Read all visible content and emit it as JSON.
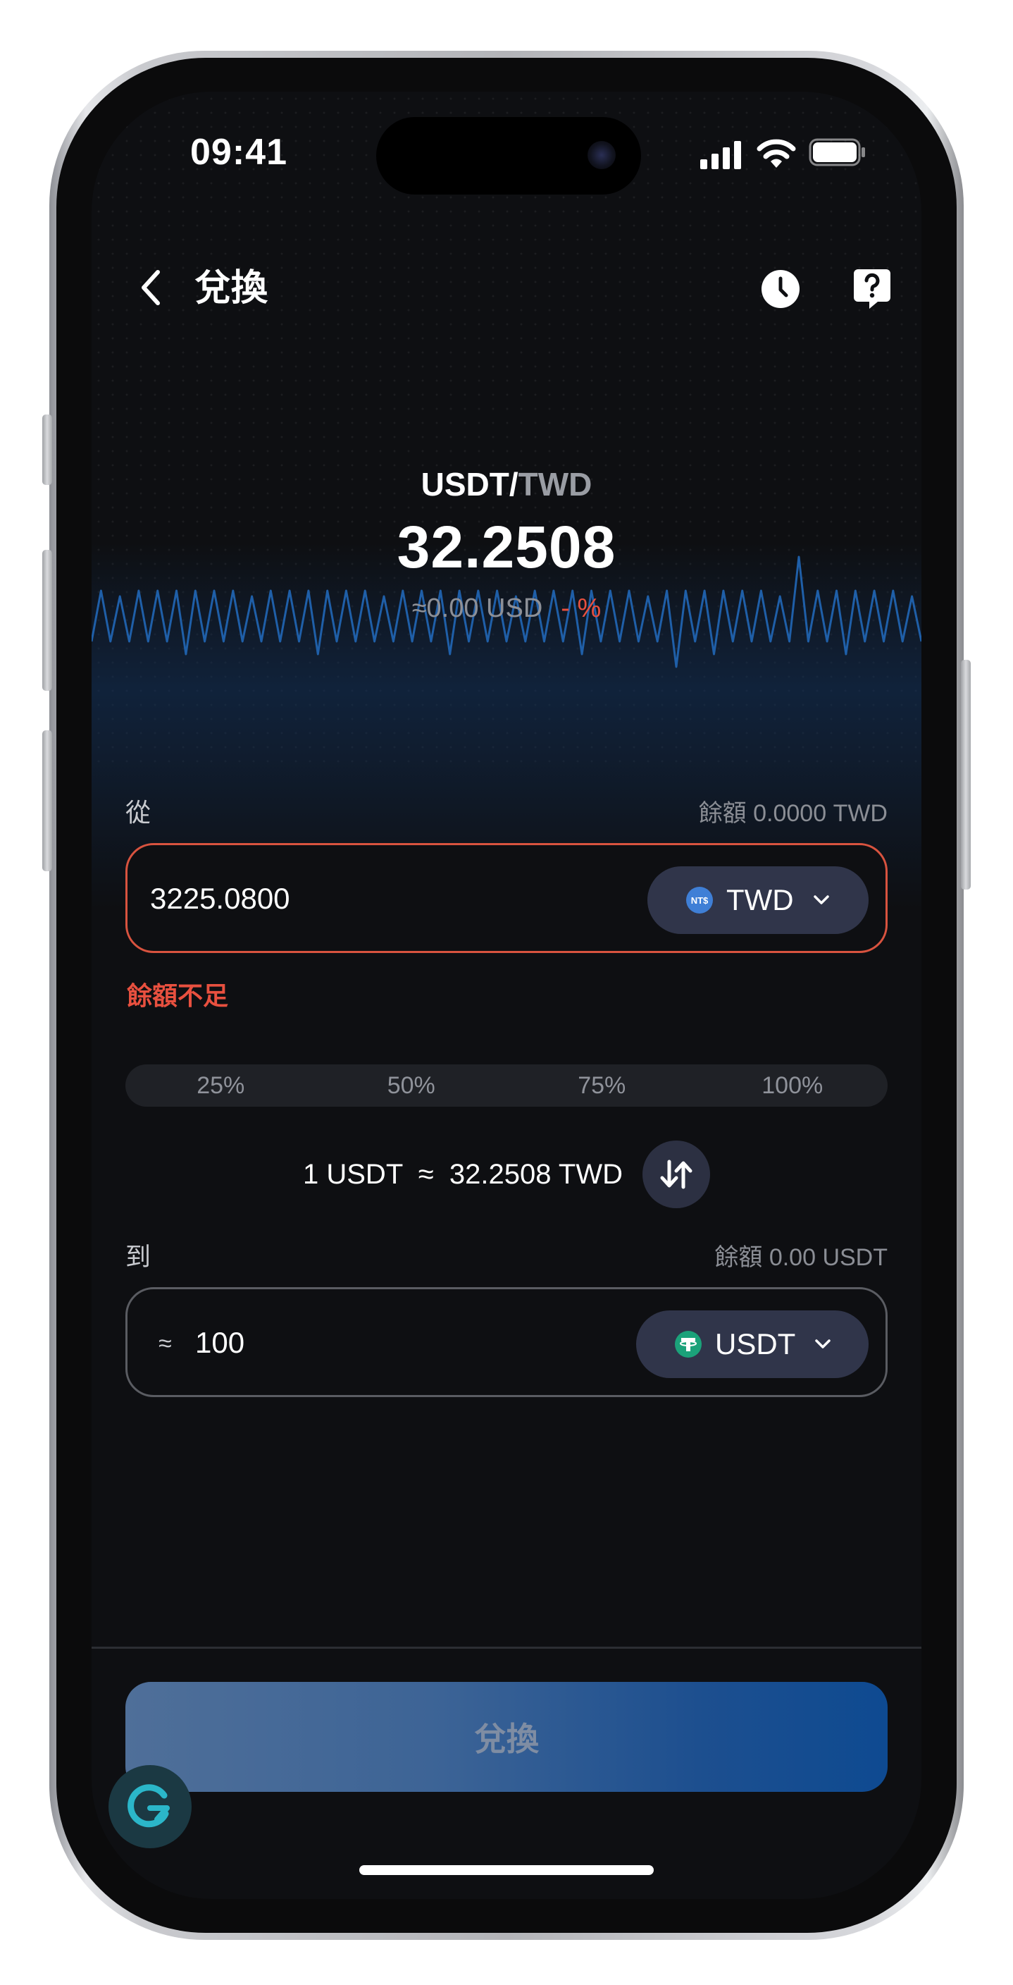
{
  "status_bar": {
    "time": "09:41"
  },
  "nav": {
    "title": "兌換"
  },
  "header": {
    "pair_base": "USDT/",
    "pair_quote": "TWD",
    "rate": "32.2508",
    "usd_value": "≈0.00 USD",
    "change": "- %",
    "change_color": "#e8503f"
  },
  "from": {
    "label": "從",
    "balance": "餘額 0.0000 TWD",
    "amount": "3225.0800",
    "currency": "TWD",
    "currency_icon": "ntd-coin-icon",
    "error": "餘額不足"
  },
  "percent_buttons": [
    "25%",
    "50%",
    "75%",
    "100%"
  ],
  "rate_line": {
    "text": "1 USDT  ≈  32.2508 TWD"
  },
  "to": {
    "label": "到",
    "balance": "餘額 0.00 USDT",
    "approx": "≈",
    "amount": "100",
    "currency": "USDT",
    "currency_icon": "tether-icon"
  },
  "submit": {
    "label": "兌換"
  },
  "colors": {
    "background": "#0e0f12",
    "error": "#e8503f",
    "pill": "#30354a",
    "button_start": "#4f6f99",
    "button_end": "#0e4a91"
  }
}
